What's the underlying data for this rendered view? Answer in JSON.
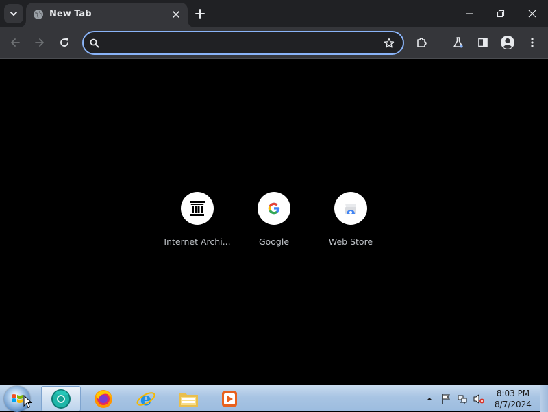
{
  "browser": {
    "tab": {
      "title": "New Tab",
      "favicon": "globe-icon"
    },
    "window_controls": [
      "minimize-icon",
      "restore-icon",
      "close-icon"
    ],
    "toolbar": {
      "omnibox": {
        "value": "",
        "placeholder": ""
      },
      "buttons": [
        "back-icon",
        "forward-icon",
        "reload-icon",
        "star-icon",
        "extensions-icon",
        "labs-icon",
        "side-panel-icon",
        "profile-icon",
        "menu-icon"
      ]
    },
    "accent_color": "#8ab4f8"
  },
  "ntp": {
    "shortcuts": [
      {
        "label": "Internet Archi...",
        "icon": "archive-icon"
      },
      {
        "label": "Google",
        "icon": "google-icon"
      },
      {
        "label": "Web Store",
        "icon": "webstore-icon"
      }
    ]
  },
  "taskbar": {
    "apps": [
      "chrome-icon",
      "firefox-icon",
      "ie-icon",
      "explorer-icon",
      "media-player-icon"
    ],
    "tray": [
      "show-hidden-icon",
      "action-center-icon",
      "network-icon",
      "volume-muted-icon"
    ],
    "clock": {
      "time": "8:03 PM",
      "date": "8/7/2024"
    }
  }
}
